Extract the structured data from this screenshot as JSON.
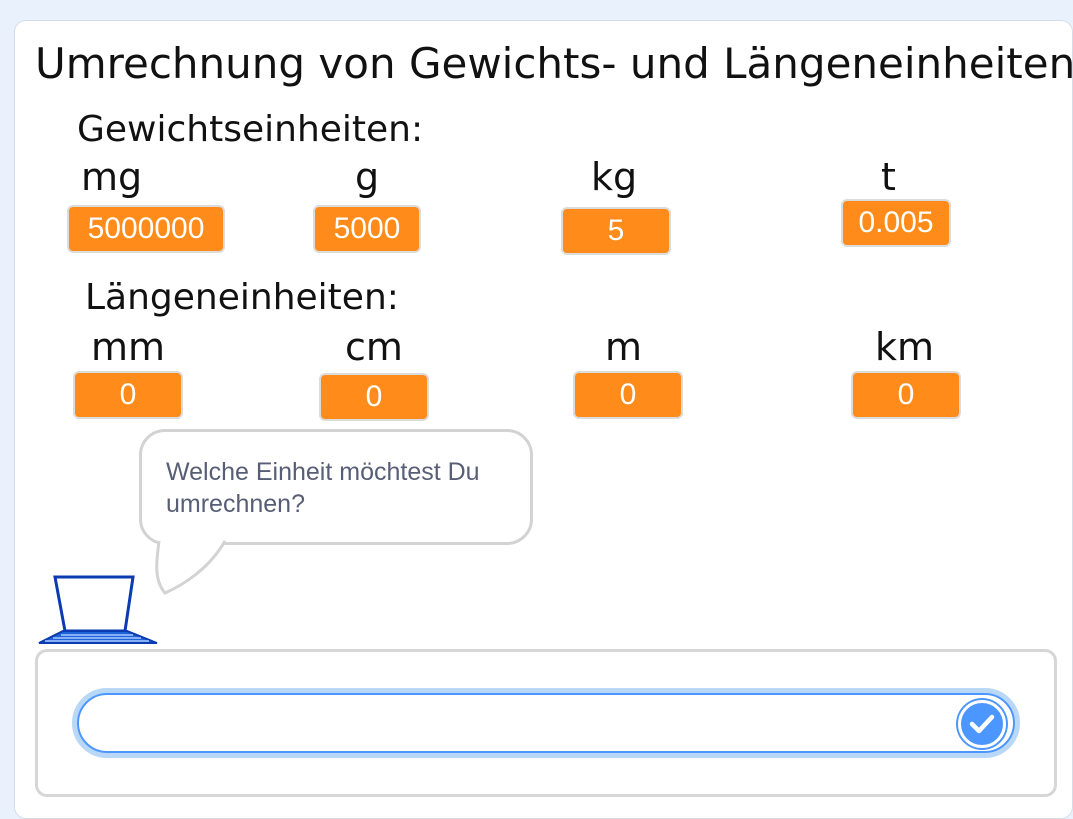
{
  "stage": {
    "title": "Umrechnung von Gewichts- und Längeneinheiten"
  },
  "weight": {
    "heading": "Gewichtseinheiten:",
    "units": [
      {
        "label": "mg",
        "value": "5000000"
      },
      {
        "label": "g",
        "value": "5000"
      },
      {
        "label": "kg",
        "value": "5"
      },
      {
        "label": "t",
        "value": "0.005"
      }
    ]
  },
  "length": {
    "heading": "Längeneinheiten:",
    "units": [
      {
        "label": "mm",
        "value": "0"
      },
      {
        "label": "cm",
        "value": "0"
      },
      {
        "label": "m",
        "value": "0"
      },
      {
        "label": "km",
        "value": "0"
      }
    ]
  },
  "speech": {
    "text": "Welche Einheit möchtest Du umrechnen?"
  },
  "ask": {
    "value": ""
  },
  "colors": {
    "variable_bg": "#ff8c1a",
    "accent": "#4c97ff",
    "sprite": "#0b3bb0"
  },
  "icons": {
    "sprite": "laptop-icon",
    "submit": "checkmark-icon"
  }
}
